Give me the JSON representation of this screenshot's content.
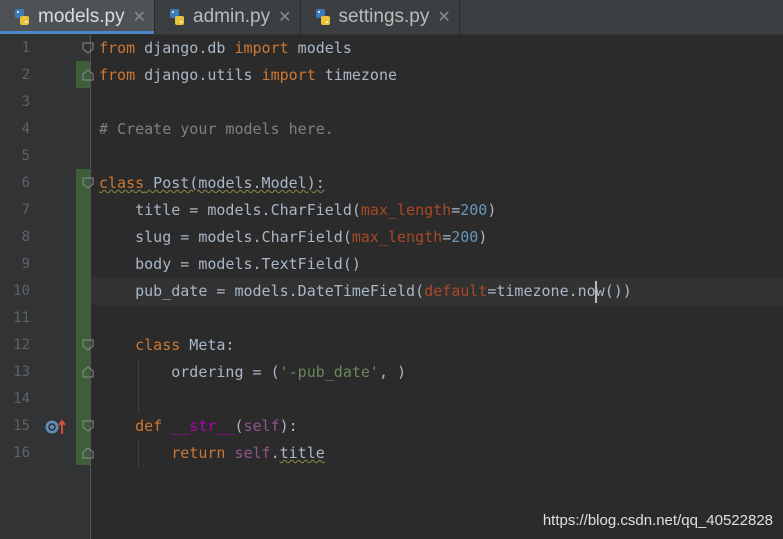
{
  "tabs": [
    {
      "label": "models.py",
      "active": true
    },
    {
      "label": "admin.py",
      "active": false
    },
    {
      "label": "settings.py",
      "active": false
    }
  ],
  "line_numbers": [
    "1",
    "2",
    "3",
    "4",
    "5",
    "6",
    "7",
    "8",
    "9",
    "10",
    "11",
    "12",
    "13",
    "14",
    "15",
    "16"
  ],
  "code": {
    "l1": {
      "kw1": "from",
      "mod": " django.db ",
      "kw2": "import",
      "name": " models"
    },
    "l2": {
      "kw1": "from",
      "mod": " django.utils ",
      "kw2": "import",
      "name": " timezone"
    },
    "l4": {
      "comment": "# Create your models here."
    },
    "l6": {
      "kw": "class",
      "rest": " Post(models.Model):"
    },
    "l7": {
      "a": "    title = models.CharField(",
      "p": "max_length",
      "eq": "=",
      "n": "200",
      "c": ")"
    },
    "l8": {
      "a": "    slug = models.CharField(",
      "p": "max_length",
      "eq": "=",
      "n": "200",
      "c": ")"
    },
    "l9": {
      "a": "    body = models.TextField()"
    },
    "l10": {
      "a": "    pub_date = models.DateTimeField(",
      "p": "default",
      "b": "=timezone.no",
      "c": "w())"
    },
    "l12": {
      "indent": "    ",
      "kw": "class",
      "rest": " Meta:"
    },
    "l13": {
      "a": "        ordering = (",
      "s": "'-pub_date'",
      "c": ", )"
    },
    "l15": {
      "indent": "    ",
      "kw": "def",
      "sp": " ",
      "fn": "__str__",
      "o": "(",
      "self": "self",
      "c": "):"
    },
    "l16": {
      "indent": "        ",
      "kw": "return",
      "sp": " ",
      "self": "self",
      "dot": ".",
      "attr": "title"
    }
  },
  "colors": {
    "keyword": "#cc7832",
    "string": "#6a8759",
    "number": "#6897bb",
    "comment": "#808080",
    "param": "#aa4926"
  },
  "watermark": "https://blog.csdn.net/qq_40522828"
}
